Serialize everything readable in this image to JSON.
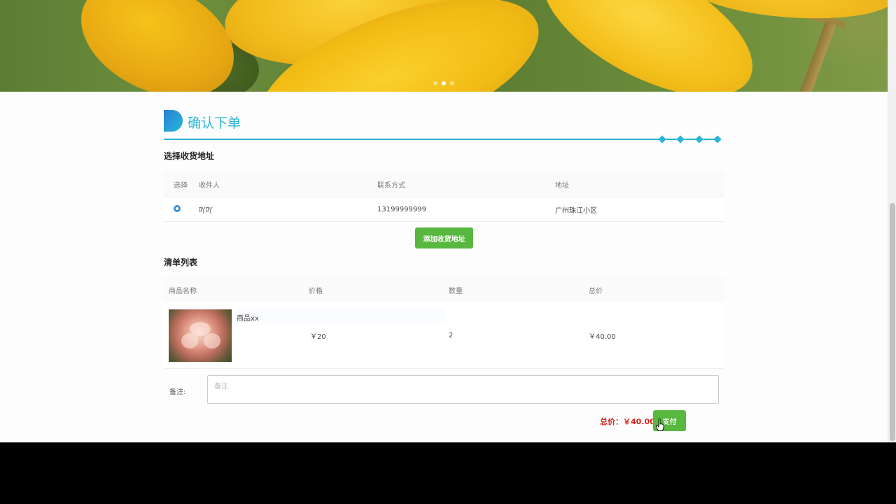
{
  "banner": {
    "slide_count": 3,
    "active_slide": 2
  },
  "header": {
    "title": "确认下单"
  },
  "address_section": {
    "label": "选择收货地址",
    "columns": [
      "选择",
      "收件人",
      "联系方式",
      "地址"
    ],
    "rows": [
      {
        "selected": true,
        "recipient": "吖吖",
        "phone": "13199999999",
        "address": "广州珠江小区"
      }
    ],
    "add_button": "添加收货地址"
  },
  "order_section": {
    "label": "清单列表",
    "columns": [
      "商品名称",
      "价格",
      "数量",
      "总价"
    ],
    "items": [
      {
        "name": "商品xx",
        "price": "￥20",
        "quantity": "2",
        "total": "￥40.00"
      }
    ]
  },
  "remark": {
    "label": "备注:",
    "placeholder": "备注",
    "value": ""
  },
  "summary": {
    "total_label": "总价：￥40.00",
    "pay_button": "支付"
  },
  "colors": {
    "accent": "#2bb5d4",
    "button": "#57b73f",
    "price": "#d4251c",
    "radio": "#3d8fe0"
  }
}
